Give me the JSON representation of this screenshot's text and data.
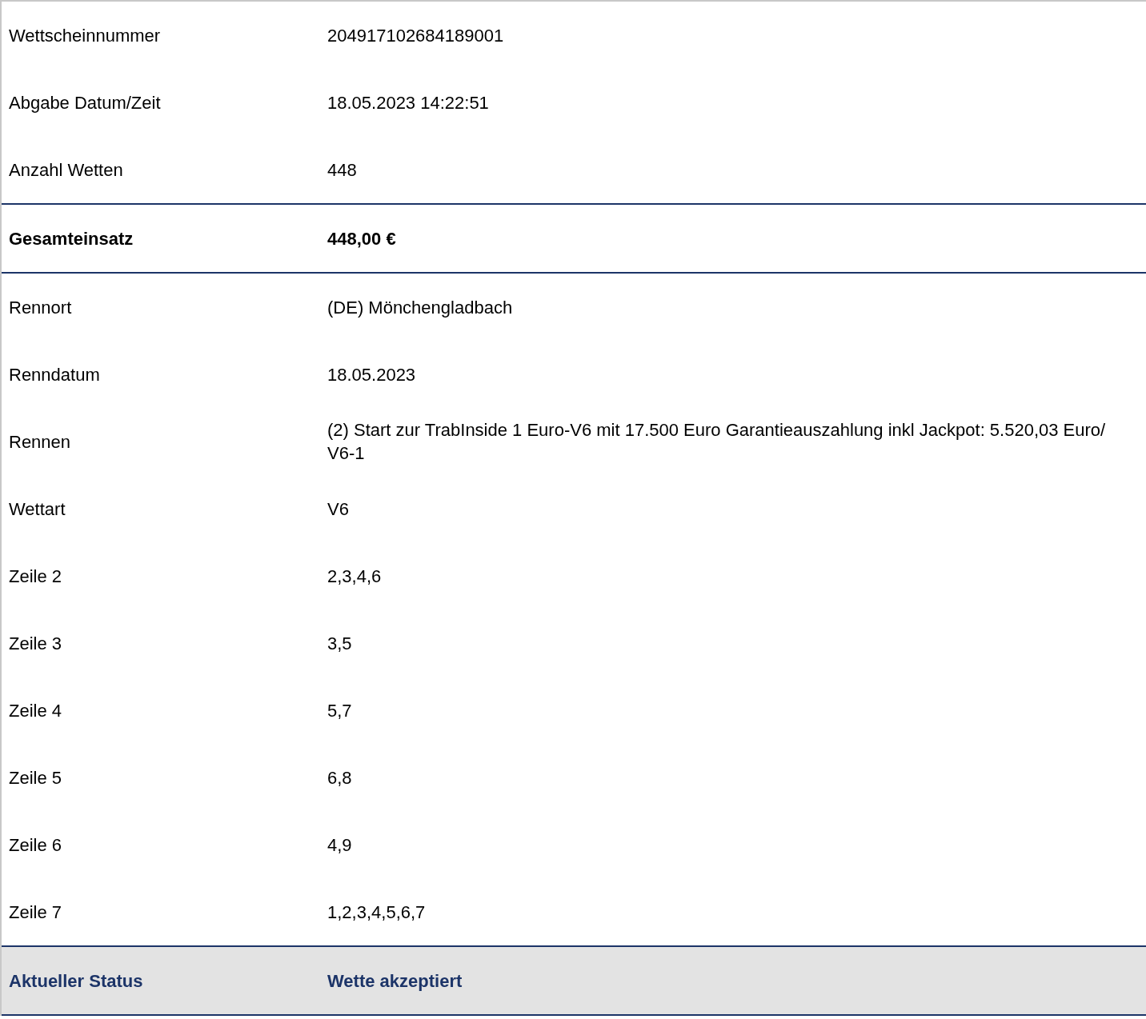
{
  "sections": [
    {
      "kind": "plain",
      "rows": [
        {
          "label": "Wettscheinnummer",
          "value": "204917102684189001"
        },
        {
          "label": "Abgabe Datum/Zeit",
          "value": "18.05.2023 14:22:51"
        },
        {
          "label": "Anzahl Wetten",
          "value": "448"
        }
      ]
    },
    {
      "kind": "total",
      "rows": [
        {
          "label": "Gesamteinsatz",
          "value": "448,00 €"
        }
      ]
    },
    {
      "kind": "plain",
      "rows": [
        {
          "label": "Rennort",
          "value": "(DE) Mönchengladbach"
        },
        {
          "label": "Renndatum",
          "value": "18.05.2023"
        },
        {
          "label": "Rennen",
          "value": "(2) Start zur TrabInside 1 Euro-V6 mit 17.500 Euro Garantieauszahlung inkl Jackpot: 5.520,03 Euro/ V6-1"
        },
        {
          "label": "Wettart",
          "value": "V6"
        },
        {
          "label": "Zeile 2",
          "value": "2,3,4,6"
        },
        {
          "label": "Zeile 3",
          "value": "3,5"
        },
        {
          "label": "Zeile 4",
          "value": "5,7"
        },
        {
          "label": "Zeile 5",
          "value": "6,8"
        },
        {
          "label": "Zeile 6",
          "value": "4,9"
        },
        {
          "label": "Zeile 7",
          "value": "1,2,3,4,5,6,7"
        }
      ]
    },
    {
      "kind": "status",
      "rows": [
        {
          "label": "Aktueller Status",
          "value": "Wette akzeptiert"
        }
      ]
    }
  ]
}
